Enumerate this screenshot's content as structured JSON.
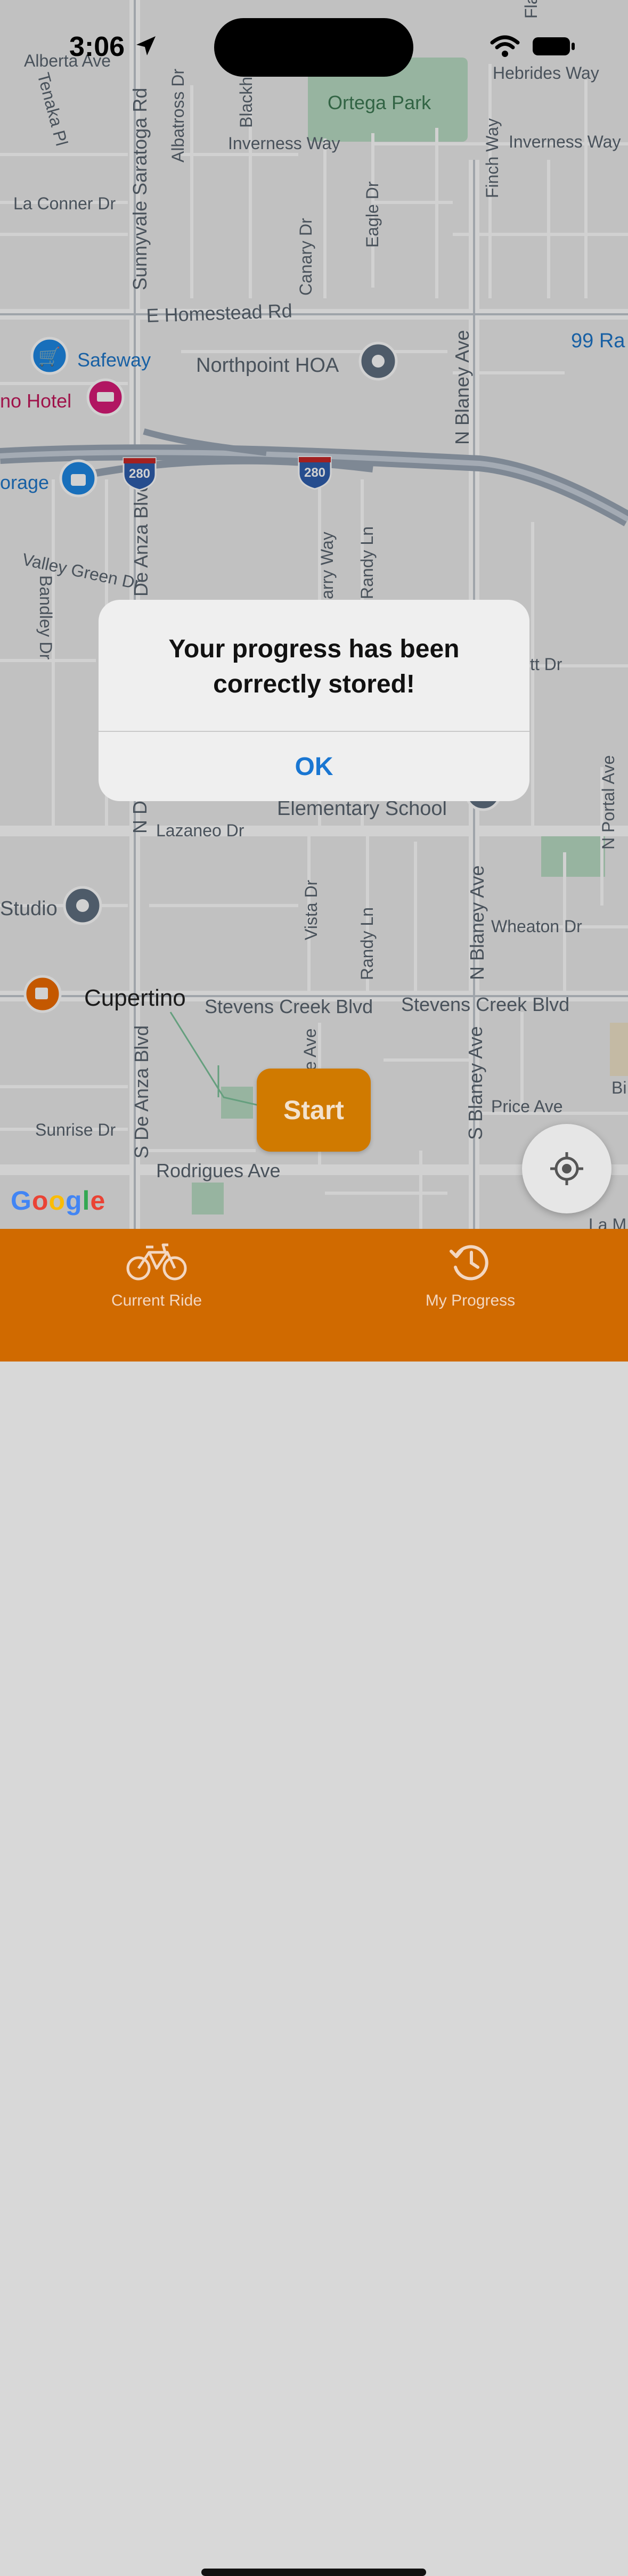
{
  "status": {
    "time": "3:06"
  },
  "map": {
    "labels": {
      "alberta": "Alberta Ave",
      "tenaka": "Tenaka Pl",
      "saratoga": "Sunnyvale Saratoga Rd",
      "albatross": "Albatross Dr",
      "blackhawk": "Blackh",
      "ortega": "Ortega Park",
      "hebrides": "Hebrides Way",
      "inverness_w": "Inverness Way",
      "inverness_e": "Inverness Way",
      "finch": "Finch Way",
      "fla": "Fla",
      "laconner": "La Conner Dr",
      "canary": "Canary Dr",
      "eagle": "Eagle Dr",
      "homestead": "E Homestead Rd",
      "safeway": "Safeway",
      "northpoint": "Northpoint HOA",
      "nblaney_n": "N Blaney Ave",
      "ranch": "99 Ra",
      "hotel": "no Hotel",
      "storage": "orage",
      "i280a": "280",
      "i280b": "280",
      "valleygreen": "Valley Green Dr",
      "bandley": "Bandley Dr",
      "deanza_n": "De Anza Blvd",
      "arry": "arry Way",
      "randy_n": "Randy Ln",
      "ttdr": "tt Dr",
      "nd": "N D",
      "elementary": "Elementary School",
      "lazaneo": "Lazaneo Dr",
      "nportal": "N Portal Ave",
      "studio": "Studio",
      "vista": "Vista Dr",
      "randy_s": "Randy Ln",
      "nblaney_s": "N Blaney Ave",
      "wheaton": "Wheaton Dr",
      "cupertino": "Cupertino",
      "stevens1": "Stevens Creek Blvd",
      "stevens2": "Stevens Creek Blvd",
      "sdeanza": "S De Anza Blvd",
      "eave": "e Ave",
      "sblaney": "S Blaney Ave",
      "price": "Price Ave",
      "bi": "Bi",
      "sunrise": "Sunrise Dr",
      "rodrigues": "Rodrigues Ave",
      "lam": "La M"
    }
  },
  "google_logo": {
    "G": "G",
    "o1": "o",
    "o2": "o",
    "g": "g",
    "l": "l",
    "e": "e"
  },
  "start_button": {
    "label": "Start"
  },
  "alert": {
    "message": "Your progress has been correctly stored!",
    "ok_label": "OK"
  },
  "tabbar": {
    "tabs": [
      {
        "label": "Current Ride",
        "icon": "bicycle-icon"
      },
      {
        "label": "My Progress",
        "icon": "history-icon"
      }
    ]
  },
  "colors": {
    "accent": "#d06a00",
    "start": "#d07a00",
    "link": "#1976d2"
  }
}
